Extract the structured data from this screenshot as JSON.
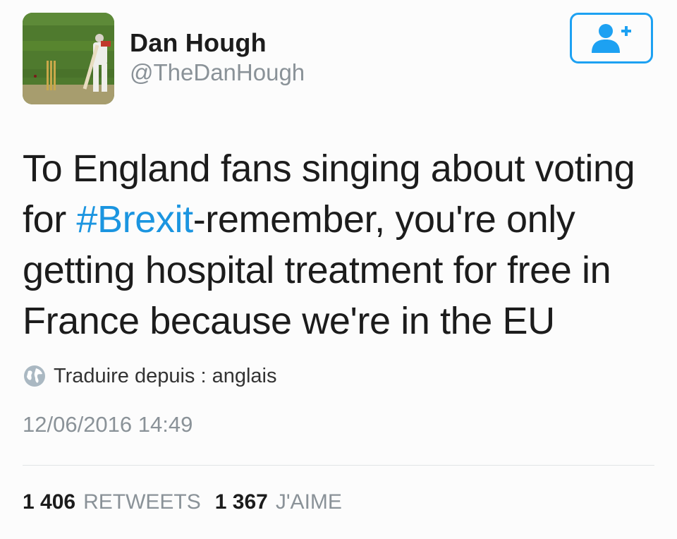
{
  "user": {
    "name": "Dan Hough",
    "handle": "@TheDanHough",
    "avatar": "cricket-batsman-photo"
  },
  "follow_button": {
    "icon": "add-user-icon",
    "color": "#1da1f2"
  },
  "tweet": {
    "text_before": "To England fans singing about voting for ",
    "hashtag": "#Brexit",
    "text_after": "-remember, you're only getting hospital treatment for free in France because we're in the EU",
    "hashtag_color": "#1b95e0"
  },
  "translate": {
    "icon": "globe-icon",
    "label": "Traduire depuis : anglais"
  },
  "timestamp": "12/06/2016 14:49",
  "stats": {
    "retweets_count": "1 406",
    "retweets_label": "RETWEETS",
    "likes_count": "1 367",
    "likes_label": "J'AIME"
  }
}
